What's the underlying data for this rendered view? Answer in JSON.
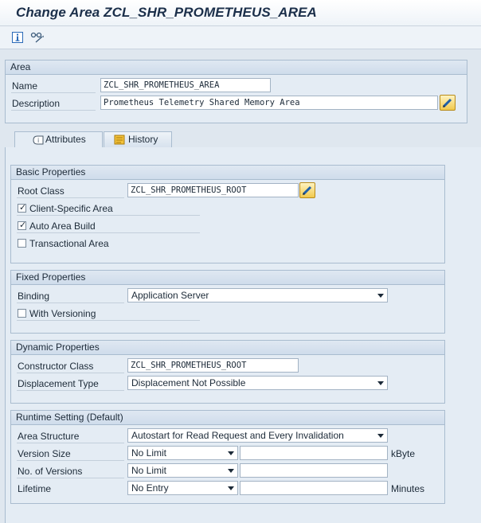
{
  "window": {
    "title": "Change Area ZCL_SHR_PROMETHEUS_AREA"
  },
  "toolbar": {
    "icons": [
      "info-icon",
      "display-object-list-icon"
    ]
  },
  "area": {
    "header": "Area",
    "name_label": "Name",
    "name_value": "ZCL_SHR_PROMETHEUS_AREA",
    "description_label": "Description",
    "description_value": "Prometheus Telemetry Shared Memory Area"
  },
  "tabs": [
    {
      "label": "Attributes",
      "active": true
    },
    {
      "label": "History",
      "active": false
    }
  ],
  "basic": {
    "header": "Basic Properties",
    "root_class_label": "Root Class",
    "root_class_value": "ZCL_SHR_PROMETHEUS_ROOT",
    "client_specific_label": "Client-Specific Area",
    "client_specific_checked": true,
    "auto_build_label": "Auto Area Build",
    "auto_build_checked": true,
    "transactional_label": "Transactional Area",
    "transactional_checked": false
  },
  "fixed": {
    "header": "Fixed Properties",
    "binding_label": "Binding",
    "binding_value": "Application Server",
    "versioning_label": "With Versioning",
    "versioning_checked": false
  },
  "dynamic": {
    "header": "Dynamic Properties",
    "constructor_label": "Constructor Class",
    "constructor_value": "ZCL_SHR_PROMETHEUS_ROOT",
    "displacement_label": "Displacement Type",
    "displacement_value": "Displacement Not Possible"
  },
  "runtime": {
    "header": "Runtime Setting (Default)",
    "area_structure_label": "Area Structure",
    "area_structure_value": "Autostart for Read Request and Every Invalidation",
    "version_size_label": "Version Size",
    "version_size_value": "No Limit",
    "version_size_unit": "kByte",
    "versions_label": "No. of Versions",
    "versions_value": "No Limit",
    "lifetime_label": "Lifetime",
    "lifetime_value": "No Entry",
    "lifetime_unit": "Minutes"
  },
  "colors": {
    "header_bg": "#cfdceb",
    "panel_bg": "#e4ecf4",
    "edit_button": "#f1c94c",
    "title": "#1b2f4a"
  }
}
